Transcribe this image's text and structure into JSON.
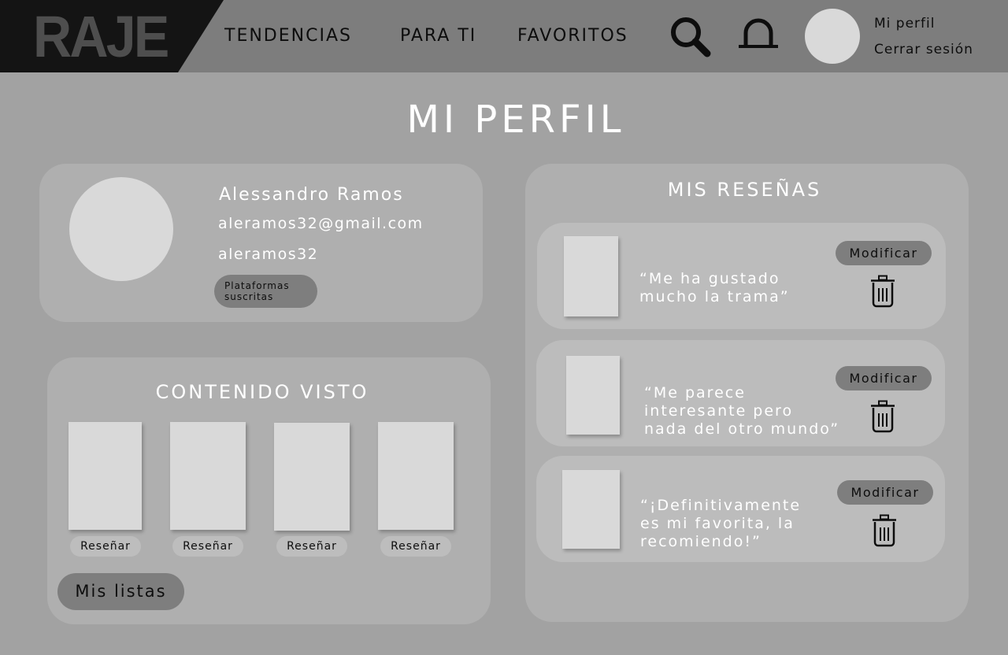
{
  "header": {
    "logo": "RAJE",
    "nav": [
      "TENDENCIAS",
      "PARA TI",
      "FAVORITOS"
    ],
    "icons": {
      "search": "search-icon",
      "notifications": "bell-icon"
    },
    "profile_link": "Mi perfil",
    "logout_link": "Cerrar sesión"
  },
  "page": {
    "title": "MI PERFIL"
  },
  "profile": {
    "name": "Alessandro Ramos",
    "email": "aleramos32@gmail.com",
    "username": "aleramos32",
    "platforms_label": "Plataformas suscritas"
  },
  "seen": {
    "title": "CONTENIDO VISTO",
    "review_label": "Reseñar",
    "lists_label": "Mis listas"
  },
  "reviews": {
    "title": "MIS RESEÑAS",
    "modify_label": "Modificar",
    "items": [
      {
        "text": "“Me ha gustado\nmucho la trama”"
      },
      {
        "text": "“Me parece\ninteresante pero\nnada del otro mundo”"
      },
      {
        "text": "“¡Definitivamente\nes mi favorita, la\nrecomiendo!”"
      }
    ]
  },
  "colors": {
    "background": "#a2a2a2",
    "header": "#7d7d7d",
    "logo_block": "#141414",
    "card": "#afafaf",
    "placeholder": "#d9d9d9",
    "button": "#7e7e7e"
  }
}
